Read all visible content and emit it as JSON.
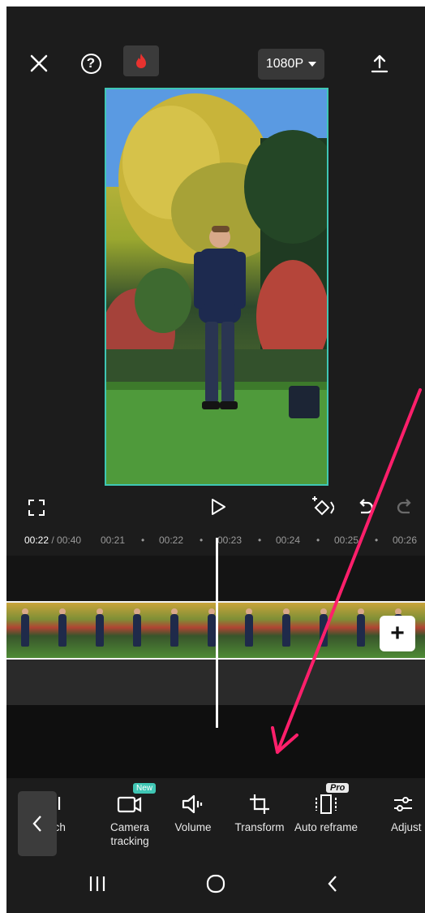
{
  "header": {
    "resolution_label": "1080P",
    "icons": [
      "close-icon",
      "help-icon",
      "fire-icon",
      "export-icon"
    ],
    "help_glyph": "?"
  },
  "playback": {
    "icons": [
      "fullscreen-icon",
      "play-icon",
      "keyframe-icon",
      "undo-icon",
      "redo-icon"
    ]
  },
  "timeline": {
    "current_time": "00:22",
    "total_time": " / 00:40",
    "ticks": [
      "00:21",
      "•",
      "00:22",
      "•",
      "00:23",
      "•",
      "00:24",
      "•",
      "00:25",
      "•",
      "00:26"
    ],
    "add_button_label": "+"
  },
  "toolbar": {
    "items": [
      {
        "label": "uch",
        "icon": "touch-icon"
      },
      {
        "label": "Camera tracking",
        "icon": "camera-tracking-icon",
        "badge": "New"
      },
      {
        "label": "Volume",
        "icon": "volume-icon"
      },
      {
        "label": "Transform",
        "icon": "transform-icon"
      },
      {
        "label": "Auto reframe",
        "icon": "auto-reframe-icon",
        "badge": "Pro"
      },
      {
        "label": "Adjust",
        "icon": "adjust-icon"
      }
    ]
  },
  "nav": {
    "icons": [
      "recent-apps-icon",
      "home-icon",
      "back-icon"
    ]
  },
  "colors": {
    "accent": "#3fc6b4",
    "annotation": "#ff1f6b",
    "background": "#1c1c1c"
  }
}
